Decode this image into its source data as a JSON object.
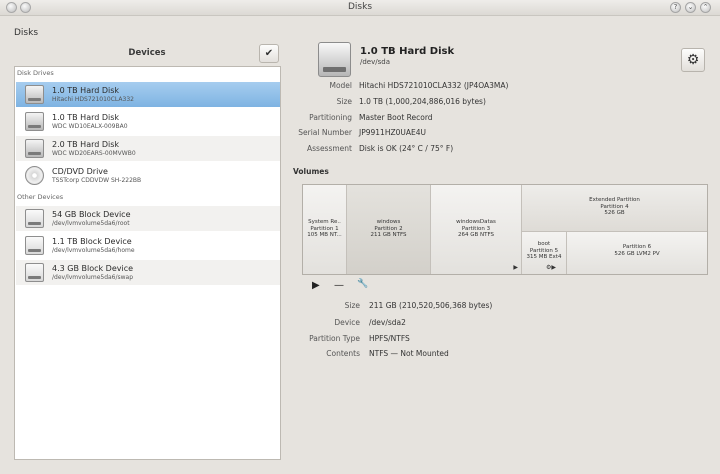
{
  "window": {
    "title": "Disks"
  },
  "app": {
    "name": "Disks"
  },
  "devices_panel": {
    "header": "Devices",
    "confirm_glyph": "✔",
    "sections": {
      "disk_drives": "Disk Drives",
      "other_devices": "Other Devices"
    },
    "disk_drives": [
      {
        "name": "1.0 TB Hard Disk",
        "model": "Hitachi HDS721010CLA332",
        "icon": "hard-disk-icon"
      },
      {
        "name": "1.0 TB Hard Disk",
        "model": "WDC WD10EALX-009BA0",
        "icon": "hard-disk-icon"
      },
      {
        "name": "2.0 TB Hard Disk",
        "model": "WDC WD20EARS-00MVWB0",
        "icon": "hard-disk-icon"
      },
      {
        "name": "CD/DVD Drive",
        "model": "TSSTcorp CDDVDW SH-222BB",
        "icon": "optical-disc-icon"
      }
    ],
    "other_devices": [
      {
        "name": "54 GB Block Device",
        "path": "/dev/lvmvolume5da6/root",
        "icon": "block-device-icon"
      },
      {
        "name": "1.1 TB Block Device",
        "path": "/dev/lvmvolume5da6/home",
        "icon": "block-device-icon"
      },
      {
        "name": "4.3 GB Block Device",
        "path": "/dev/lvmvolume5da6/swap",
        "icon": "block-device-icon"
      }
    ]
  },
  "disk": {
    "title": "1.0 TB Hard Disk",
    "device": "/dev/sda",
    "gear_glyph": "⚙",
    "properties": [
      {
        "label": "Model",
        "value": "Hitachi HDS721010CLA332 (JP4OA3MA)"
      },
      {
        "label": "Size",
        "value": "1.0 TB (1,000,204,886,016 bytes)"
      },
      {
        "label": "Partitioning",
        "value": "Master Boot Record"
      },
      {
        "label": "Serial Number",
        "value": "JP9911HZ0UAE4U"
      },
      {
        "label": "Assessment",
        "value": "Disk is OK (24° C / 75° F)"
      }
    ]
  },
  "volumes": {
    "header": "Volumes",
    "partitions": [
      {
        "l1": "System Re..",
        "l2": "Partition 1",
        "l3": "105 MB NT..."
      },
      {
        "l1": "windows",
        "l2": "Partition 2",
        "l3": "211 GB NTFS"
      },
      {
        "l1": "windowsDatas",
        "l2": "Partition 3",
        "l3": "264 GB NTFS"
      },
      {
        "l1": "Extended Partition",
        "l2": "Partition 4",
        "l3": "526 GB"
      },
      {
        "l1": "boot",
        "l2": "Partition 5",
        "l3": "315 MB Ext4"
      },
      {
        "l1": "",
        "l2": "Partition 6",
        "l3": "526 GB LVM2 PV"
      }
    ],
    "toolbar": {
      "play": "▶",
      "minus": "—",
      "wrench": "🔧"
    },
    "details": [
      {
        "label": "Size",
        "value": "211 GB (210,520,506,368 bytes)"
      },
      {
        "label": "Device",
        "value": "/dev/sda2"
      },
      {
        "label": "Partition Type",
        "value": "HPFS/NTFS"
      },
      {
        "label": "Contents",
        "value": "NTFS — Not Mounted"
      }
    ]
  },
  "colors": {
    "selection": "#7eb3e2",
    "background": "#e6e3de"
  }
}
